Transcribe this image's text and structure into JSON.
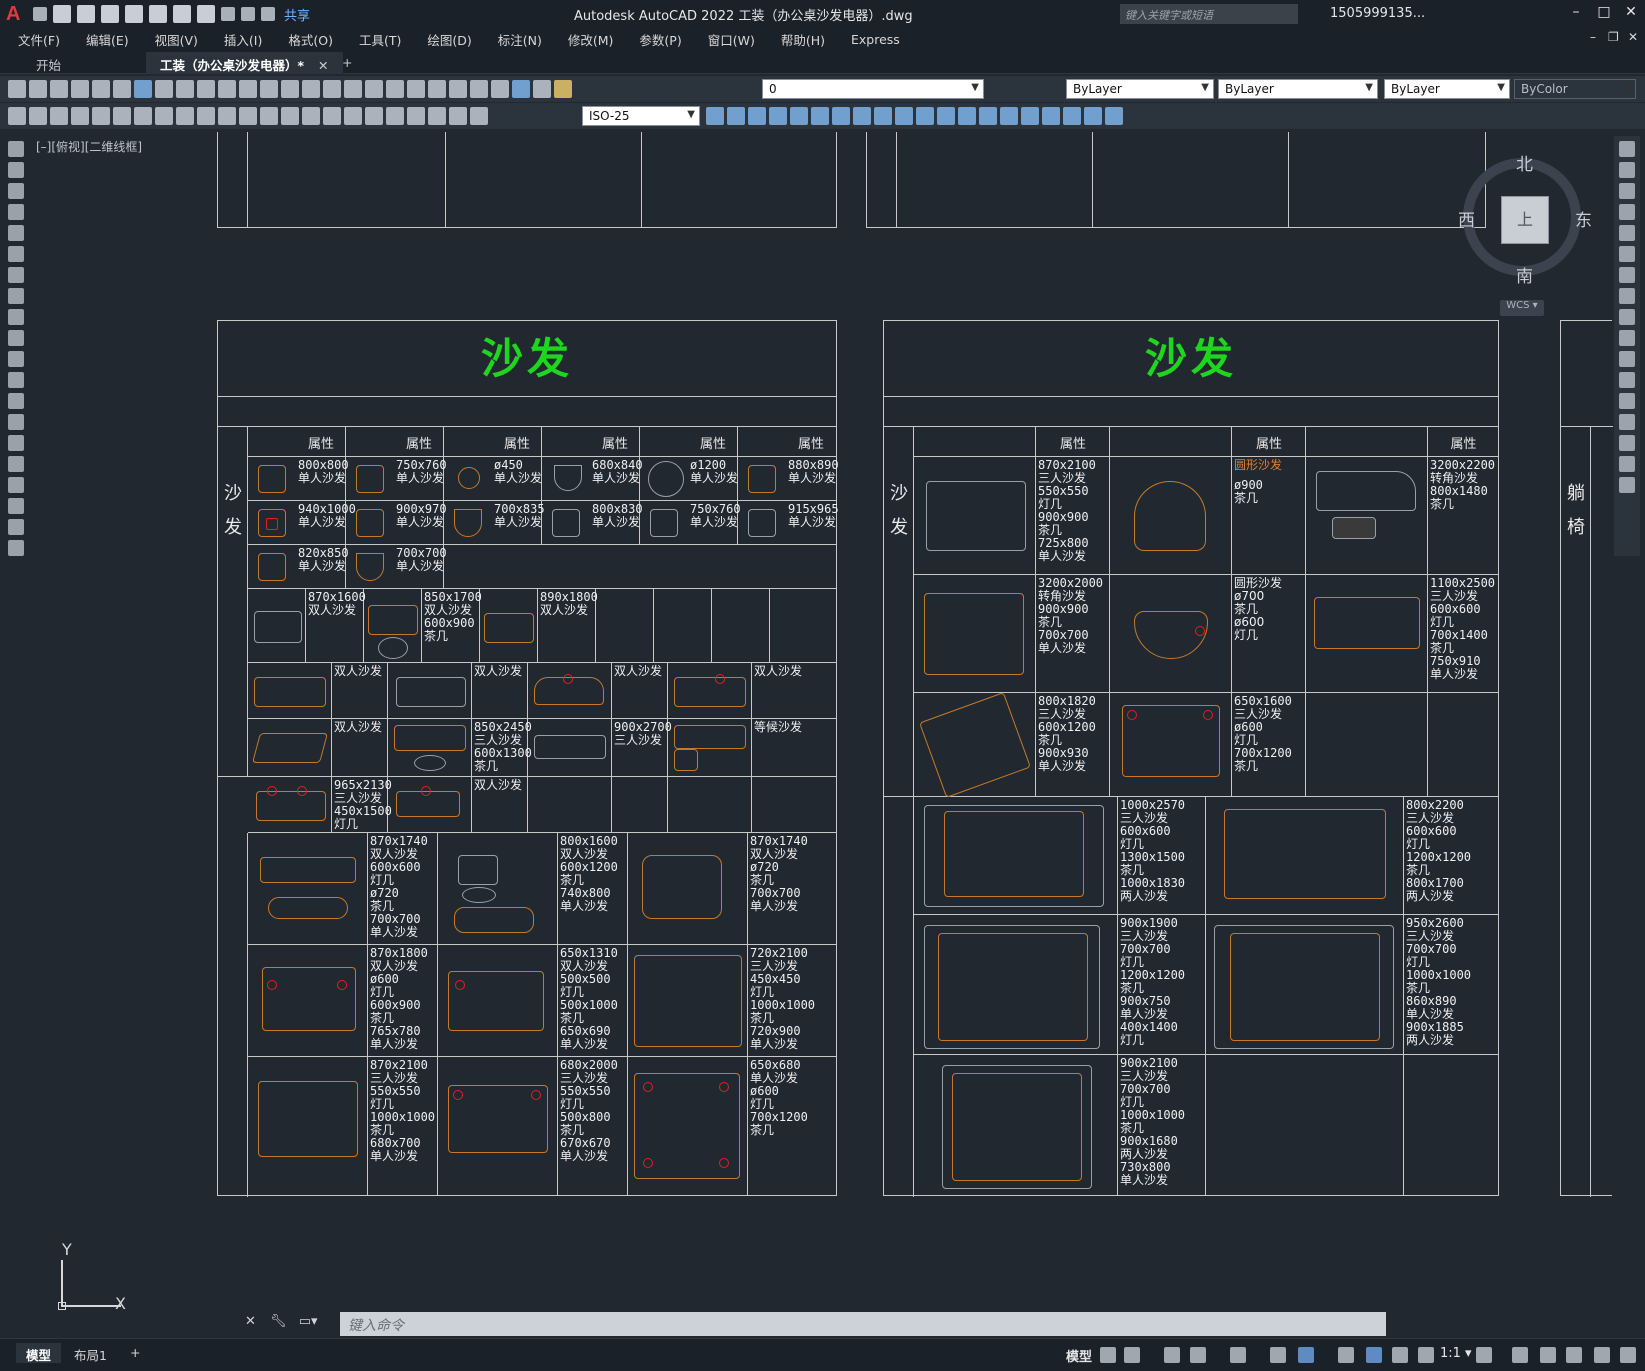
{
  "titlebar": {
    "logo": "A",
    "share_label": "共享",
    "title": "Autodesk AutoCAD 2022    工装（办公桌沙发电器）.dwg",
    "search_placeholder": "键入关键字或短语",
    "user": "1505999135...",
    "min": "–",
    "max": "□",
    "close": "✕"
  },
  "menubar": {
    "items": [
      "文件(F)",
      "编辑(E)",
      "视图(V)",
      "插入(I)",
      "格式(O)",
      "工具(T)",
      "绘图(D)",
      "标注(N)",
      "修改(M)",
      "参数(P)",
      "窗口(W)",
      "帮助(H)",
      "Express"
    ],
    "ctrl_min": "–",
    "ctrl_restore": "❐",
    "ctrl_close": "✕"
  },
  "tabs": {
    "start": "开始",
    "active": "工装（办公桌沙发电器）*",
    "close": "✕",
    "add": "+"
  },
  "toolbar1": {
    "layer": "0",
    "color": "ByLayer",
    "linetype": "ByLayer",
    "lineweight": "ByLayer",
    "plotstyle": "ByColor"
  },
  "toolbar2": {
    "dimstyle": "ISO-25"
  },
  "viewport": {
    "label": "[–][俯视][二维线框]"
  },
  "compass": {
    "north": "北",
    "south": "南",
    "east": "东",
    "west": "西",
    "cube": "上",
    "wcs": "WCS ▾"
  },
  "left_panel": {
    "title": "沙发",
    "header": "属性",
    "category": [
      "沙",
      "发"
    ],
    "row1": [
      "800x800\n单人沙发",
      "750x760\n单人沙发",
      "ø450\n单人沙发",
      "680x840\n单人沙发",
      "ø1200\n单人沙发",
      "880x890\n单人沙发"
    ],
    "row2": [
      "940x1000\n单人沙发",
      "900x970\n单人沙发",
      "700x835\n单人沙发",
      "800x830\n单人沙发",
      "750x760\n单人沙发",
      "915x965\n单人沙发"
    ],
    "row3": [
      "820x850\n单人沙发",
      "700x700\n单人沙发"
    ],
    "row4": [
      "870x1600\n双人沙发",
      "850x1700\n双人沙发\n600x900\n茶几",
      "890x1800\n双人沙发"
    ],
    "row5": [
      "双人沙发",
      "双人沙发",
      "双人沙发",
      "双人沙发"
    ],
    "row6": [
      "双人沙发",
      "850x2450\n三人沙发\n600x1300\n茶几",
      "900x2700\n三人沙发",
      "等候沙发"
    ],
    "row7": [
      "965x2130\n三人沙发\n450x1500\n灯几",
      "双人沙发"
    ],
    "row8": [
      "870x1740\n双人沙发\n600x600\n灯几\nø720\n茶几\n700x700\n单人沙发",
      "800x1600\n双人沙发\n600x1200\n茶几\n740x800\n单人沙发",
      "870x1740\n双人沙发\nø720\n茶几\n700x700\n单人沙发"
    ],
    "row9": [
      "870x1800\n双人沙发\nø600\n灯几\n600x900\n茶几\n765x780\n单人沙发",
      "650x1310\n双人沙发\n500x500\n灯几\n500x1000\n茶几\n650x690\n单人沙发",
      "720x2100\n三人沙发\n450x450\n灯几\n1000x1000\n茶几\n720x900\n单人沙发"
    ],
    "row10": [
      "870x2100\n三人沙发\n550x550\n灯几\n1000x1000\n茶几\n680x700\n单人沙发",
      "680x2000\n三人沙发\n550x550\n灯几\n500x800\n茶几\n670x670\n单人沙发",
      "650x680\n单人沙发\nø600\n灯几\n700x1200\n茶几"
    ]
  },
  "right_panel": {
    "title": "沙发",
    "header": "属性",
    "category": [
      "沙",
      "发"
    ],
    "row1": [
      "870x2100\n三人沙发\n550x550\n灯几\n900x900\n茶几\n725x800\n单人沙发",
      "圆形沙发",
      "ø900\n茶几",
      "3200x2200\n转角沙发\n800x1480\n茶几"
    ],
    "row2": [
      "3200x2000\n转角沙发\n900x900\n茶几\n700x700\n单人沙发",
      "圆形沙发\nø700\n茶几\nø600\n灯几",
      "1100x2500\n三人沙发\n600x600\n灯几\n700x1400\n茶几\n750x910\n单人沙发"
    ],
    "row3": [
      "800x1820\n三人沙发\n600x1200\n茶几\n900x930\n单人沙发",
      "650x1600\n三人沙发\nø600\n灯几\n700x1200\n茶几"
    ],
    "row4": [
      "1000x2570\n三人沙发\n600x600\n灯几\n1300x1500\n茶几\n1000x1830\n两人沙发",
      "800x2200\n三人沙发\n600x600\n灯几\n1200x1200\n茶几\n800x1700\n两人沙发"
    ],
    "row5": [
      "900x1900\n三人沙发\n700x700\n灯几\n1200x1200\n茶几\n900x750\n单人沙发\n400x1400\n灯几",
      "950x2600\n三人沙发\n700x700\n灯几\n1000x1000\n茶几\n860x890\n单人沙发\n900x1885\n两人沙发"
    ],
    "row6": [
      "900x2100\n三人沙发\n700x700\n灯几\n1000x1000\n茶几\n900x1680\n两人沙发\n730x800\n单人沙发"
    ]
  },
  "edge_panel": {
    "category": [
      "躺",
      "椅"
    ]
  },
  "ucs": {
    "x": "X",
    "y": "Y"
  },
  "command": {
    "placeholder": "键入命令"
  },
  "statusbar": {
    "tab_model": "模型",
    "tab_layout": "布局1",
    "add": "+",
    "mode": "模型",
    "scale": "1:1 ▾"
  }
}
